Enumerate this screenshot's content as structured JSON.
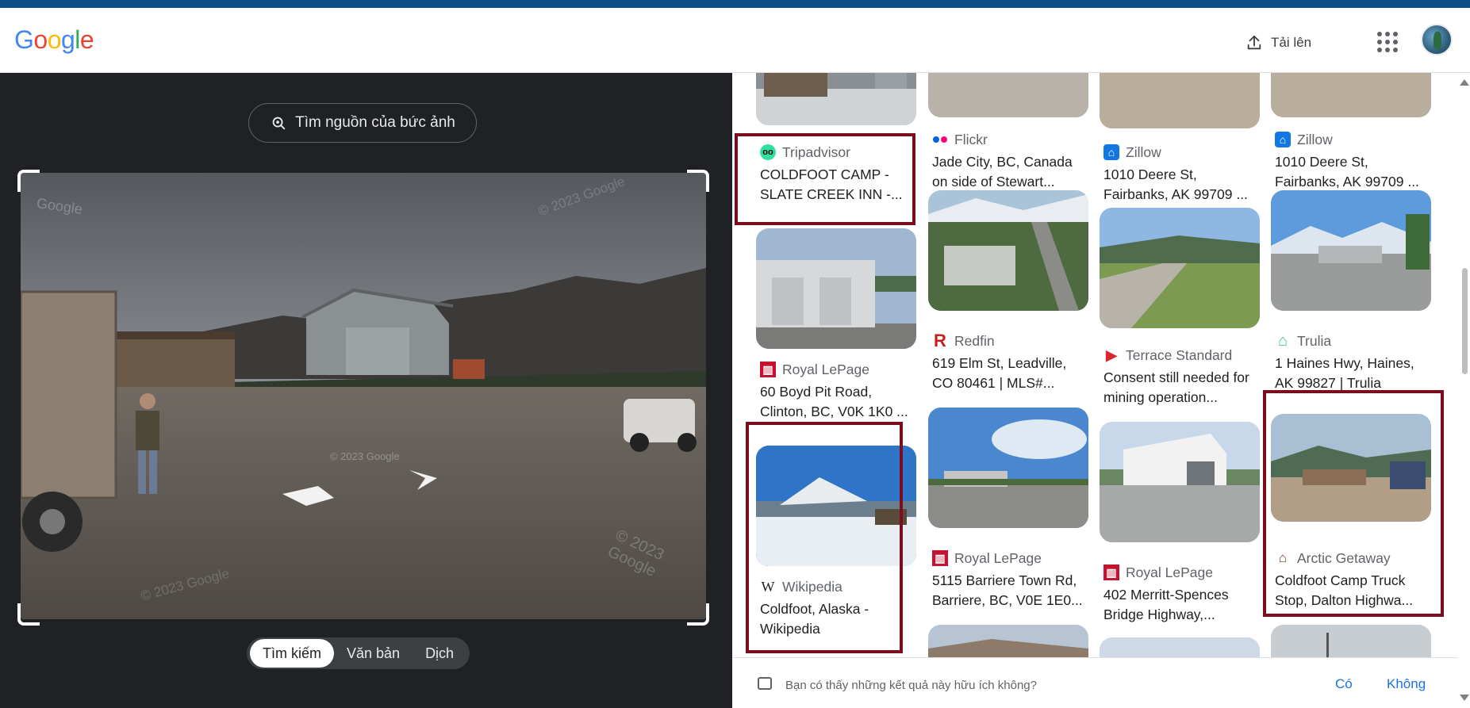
{
  "header": {
    "logo_letters": [
      {
        "char": "G",
        "color": "#4285f4"
      },
      {
        "char": "o",
        "color": "#ea4335"
      },
      {
        "char": "o",
        "color": "#fbbc05"
      },
      {
        "char": "g",
        "color": "#4285f4"
      },
      {
        "char": "l",
        "color": "#34a853"
      },
      {
        "char": "e",
        "color": "#ea4335"
      }
    ],
    "upload_label": "Tải lên"
  },
  "left": {
    "source_button": "Tìm nguồn của bức ảnh",
    "modes": [
      "Tìm kiếm",
      "Văn bản",
      "Dịch"
    ],
    "watermarks": [
      "Google",
      "© 2023 Google",
      "© 2023 Google",
      "© 2023 Google",
      "© 2023 Google"
    ]
  },
  "results": {
    "col1": [
      {
        "source": "Tripadvisor",
        "title": "COLDFOOT CAMP - SLATE CREEK INN -..."
      },
      {
        "source": "Royal LePage",
        "title": "60 Boyd Pit Road, Clinton, BC, V0K 1K0 ..."
      },
      {
        "source": "Wikipedia",
        "title": "Coldfoot, Alaska - Wikipedia"
      }
    ],
    "col2": [
      {
        "source": "Flickr",
        "title": "Jade City, BC, Canada on side of Stewart..."
      },
      {
        "source": "Redfin",
        "title": "619 Elm St, Leadville, CO 80461 | MLS#..."
      },
      {
        "source": "Royal LePage",
        "title": "5115 Barriere Town Rd, Barriere, BC, V0E 1E0..."
      }
    ],
    "col3": [
      {
        "source": "Zillow",
        "title": "1010 Deere St, Fairbanks, AK 99709 ..."
      },
      {
        "source": "Terrace Standard",
        "title": "Consent still needed for mining operation..."
      },
      {
        "source": "Royal LePage",
        "title": "402 Merritt-Spences Bridge Highway,..."
      }
    ],
    "col4": [
      {
        "source": "Zillow",
        "title": "1010 Deere St, Fairbanks, AK 99709 ..."
      },
      {
        "source": "Trulia",
        "title": "1 Haines Hwy, Haines, AK 99827 | Trulia"
      },
      {
        "source": "Arctic Getaway",
        "title": "Coldfoot Camp Truck Stop, Dalton Highwa..."
      }
    ]
  },
  "feedback": {
    "question": "Bạn có thấy những kết quả này hữu ích không?",
    "yes": "Có",
    "no": "Không"
  },
  "colors": {
    "highlight": "#7b0d1e",
    "link": "#1a73e8",
    "dark_panel": "#202124"
  }
}
